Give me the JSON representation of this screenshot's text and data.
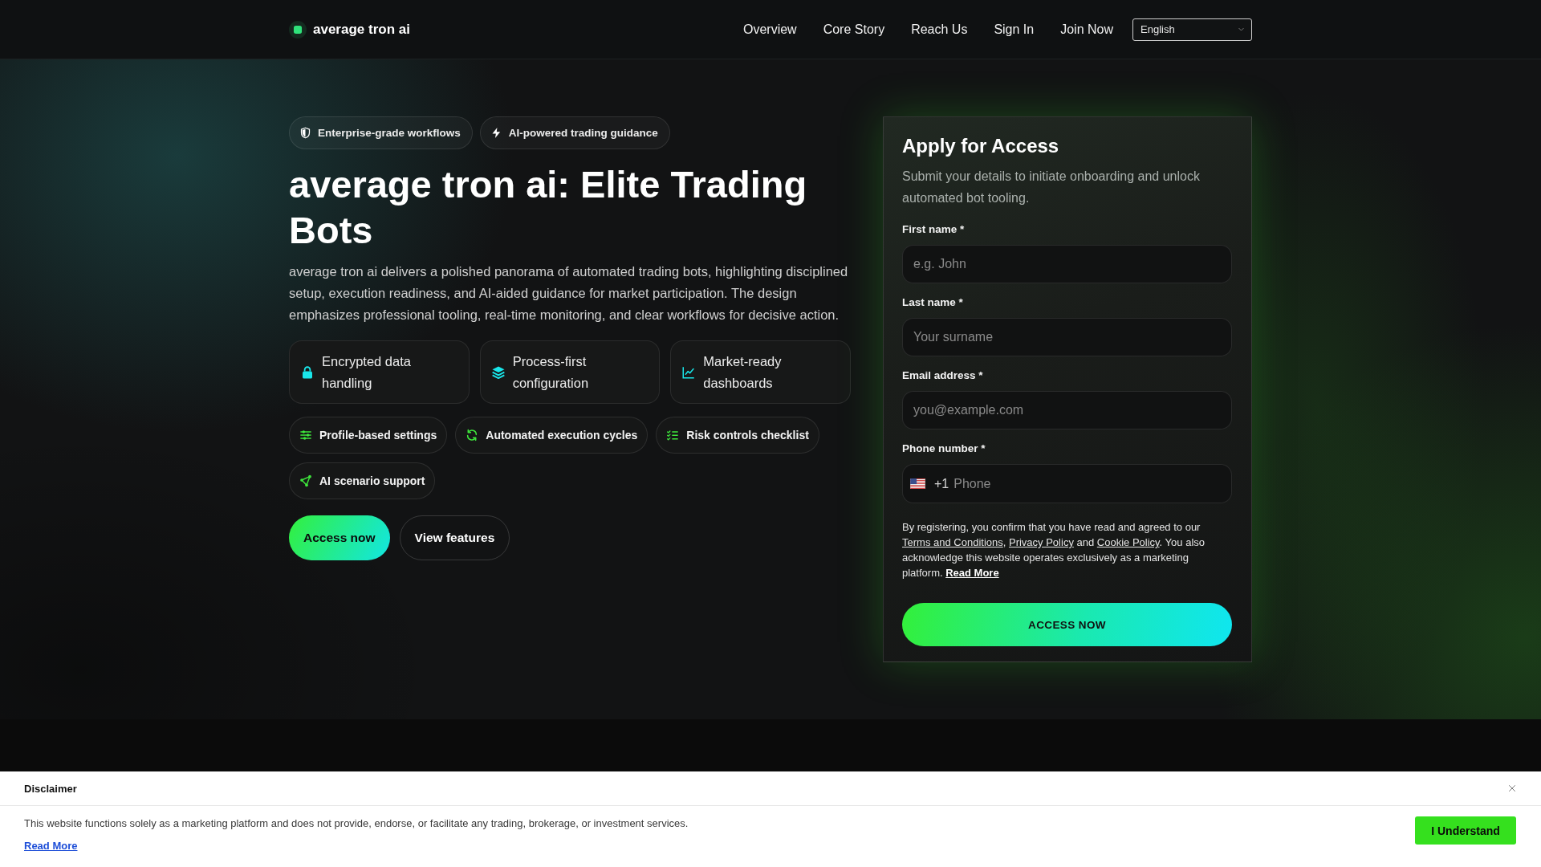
{
  "header": {
    "brand": "average tron ai",
    "nav": [
      "Overview",
      "Core Story",
      "Reach Us",
      "Sign In",
      "Join Now"
    ],
    "language_select": {
      "value": "English"
    }
  },
  "hero": {
    "highlights": [
      "Enterprise-grade workflows",
      "AI-powered trading guidance"
    ],
    "title": "average tron ai: Elite Trading Bots",
    "description": "average tron ai delivers a polished panorama of automated trading bots, highlighting disciplined setup, execution readiness, and AI-aided guidance for market participation. The design emphasizes professional tooling, real-time monitoring, and clear workflows for decisive action.",
    "feature_cards": [
      "Encrypted data handling",
      "Process-first configuration",
      "Market-ready dashboards"
    ],
    "feature_chips": [
      "Profile-based settings",
      "Automated execution cycles",
      "Risk controls checklist",
      "AI scenario support"
    ],
    "buttons": [
      {
        "label": "Access now",
        "kind": "primary"
      },
      {
        "label": "View features",
        "kind": "secondary"
      }
    ]
  },
  "signup_form": {
    "title": "Apply for Access",
    "subtitle": "Submit your details to initiate onboarding and unlock automated bot tooling.",
    "fields": [
      {
        "kind": "text",
        "label": "First name *",
        "placeholder": "e.g. John"
      },
      {
        "kind": "text",
        "label": "Last name *",
        "placeholder": "Your surname"
      },
      {
        "kind": "text",
        "label": "Email address *",
        "placeholder": "you@example.com"
      },
      {
        "kind": "phone",
        "label": "Phone number *",
        "dial_code": "+1",
        "placeholder": "Phone"
      }
    ],
    "consent": [
      {
        "kind": "text",
        "text": "By registering, you confirm that you have read and agreed to our "
      },
      {
        "kind": "link",
        "text": "Terms and Conditions"
      },
      {
        "kind": "text",
        "text": ", "
      },
      {
        "kind": "link",
        "text": "Privacy Policy"
      },
      {
        "kind": "text",
        "text": " and "
      },
      {
        "kind": "link",
        "text": "Cookie Policy"
      },
      {
        "kind": "text",
        "text": ". You also acknowledge this website operates exclusively as a marketing platform. "
      },
      {
        "kind": "more_link",
        "text": "Read More"
      }
    ],
    "submit": "ACCESS NOW"
  },
  "disclaimer": {
    "title": "Disclaimer",
    "text": "This website functions solely as a marketing platform and does not provide, endorse, or facilitate any trading, brokerage, or investment services.",
    "link": "Read More",
    "button": "I Understand"
  }
}
